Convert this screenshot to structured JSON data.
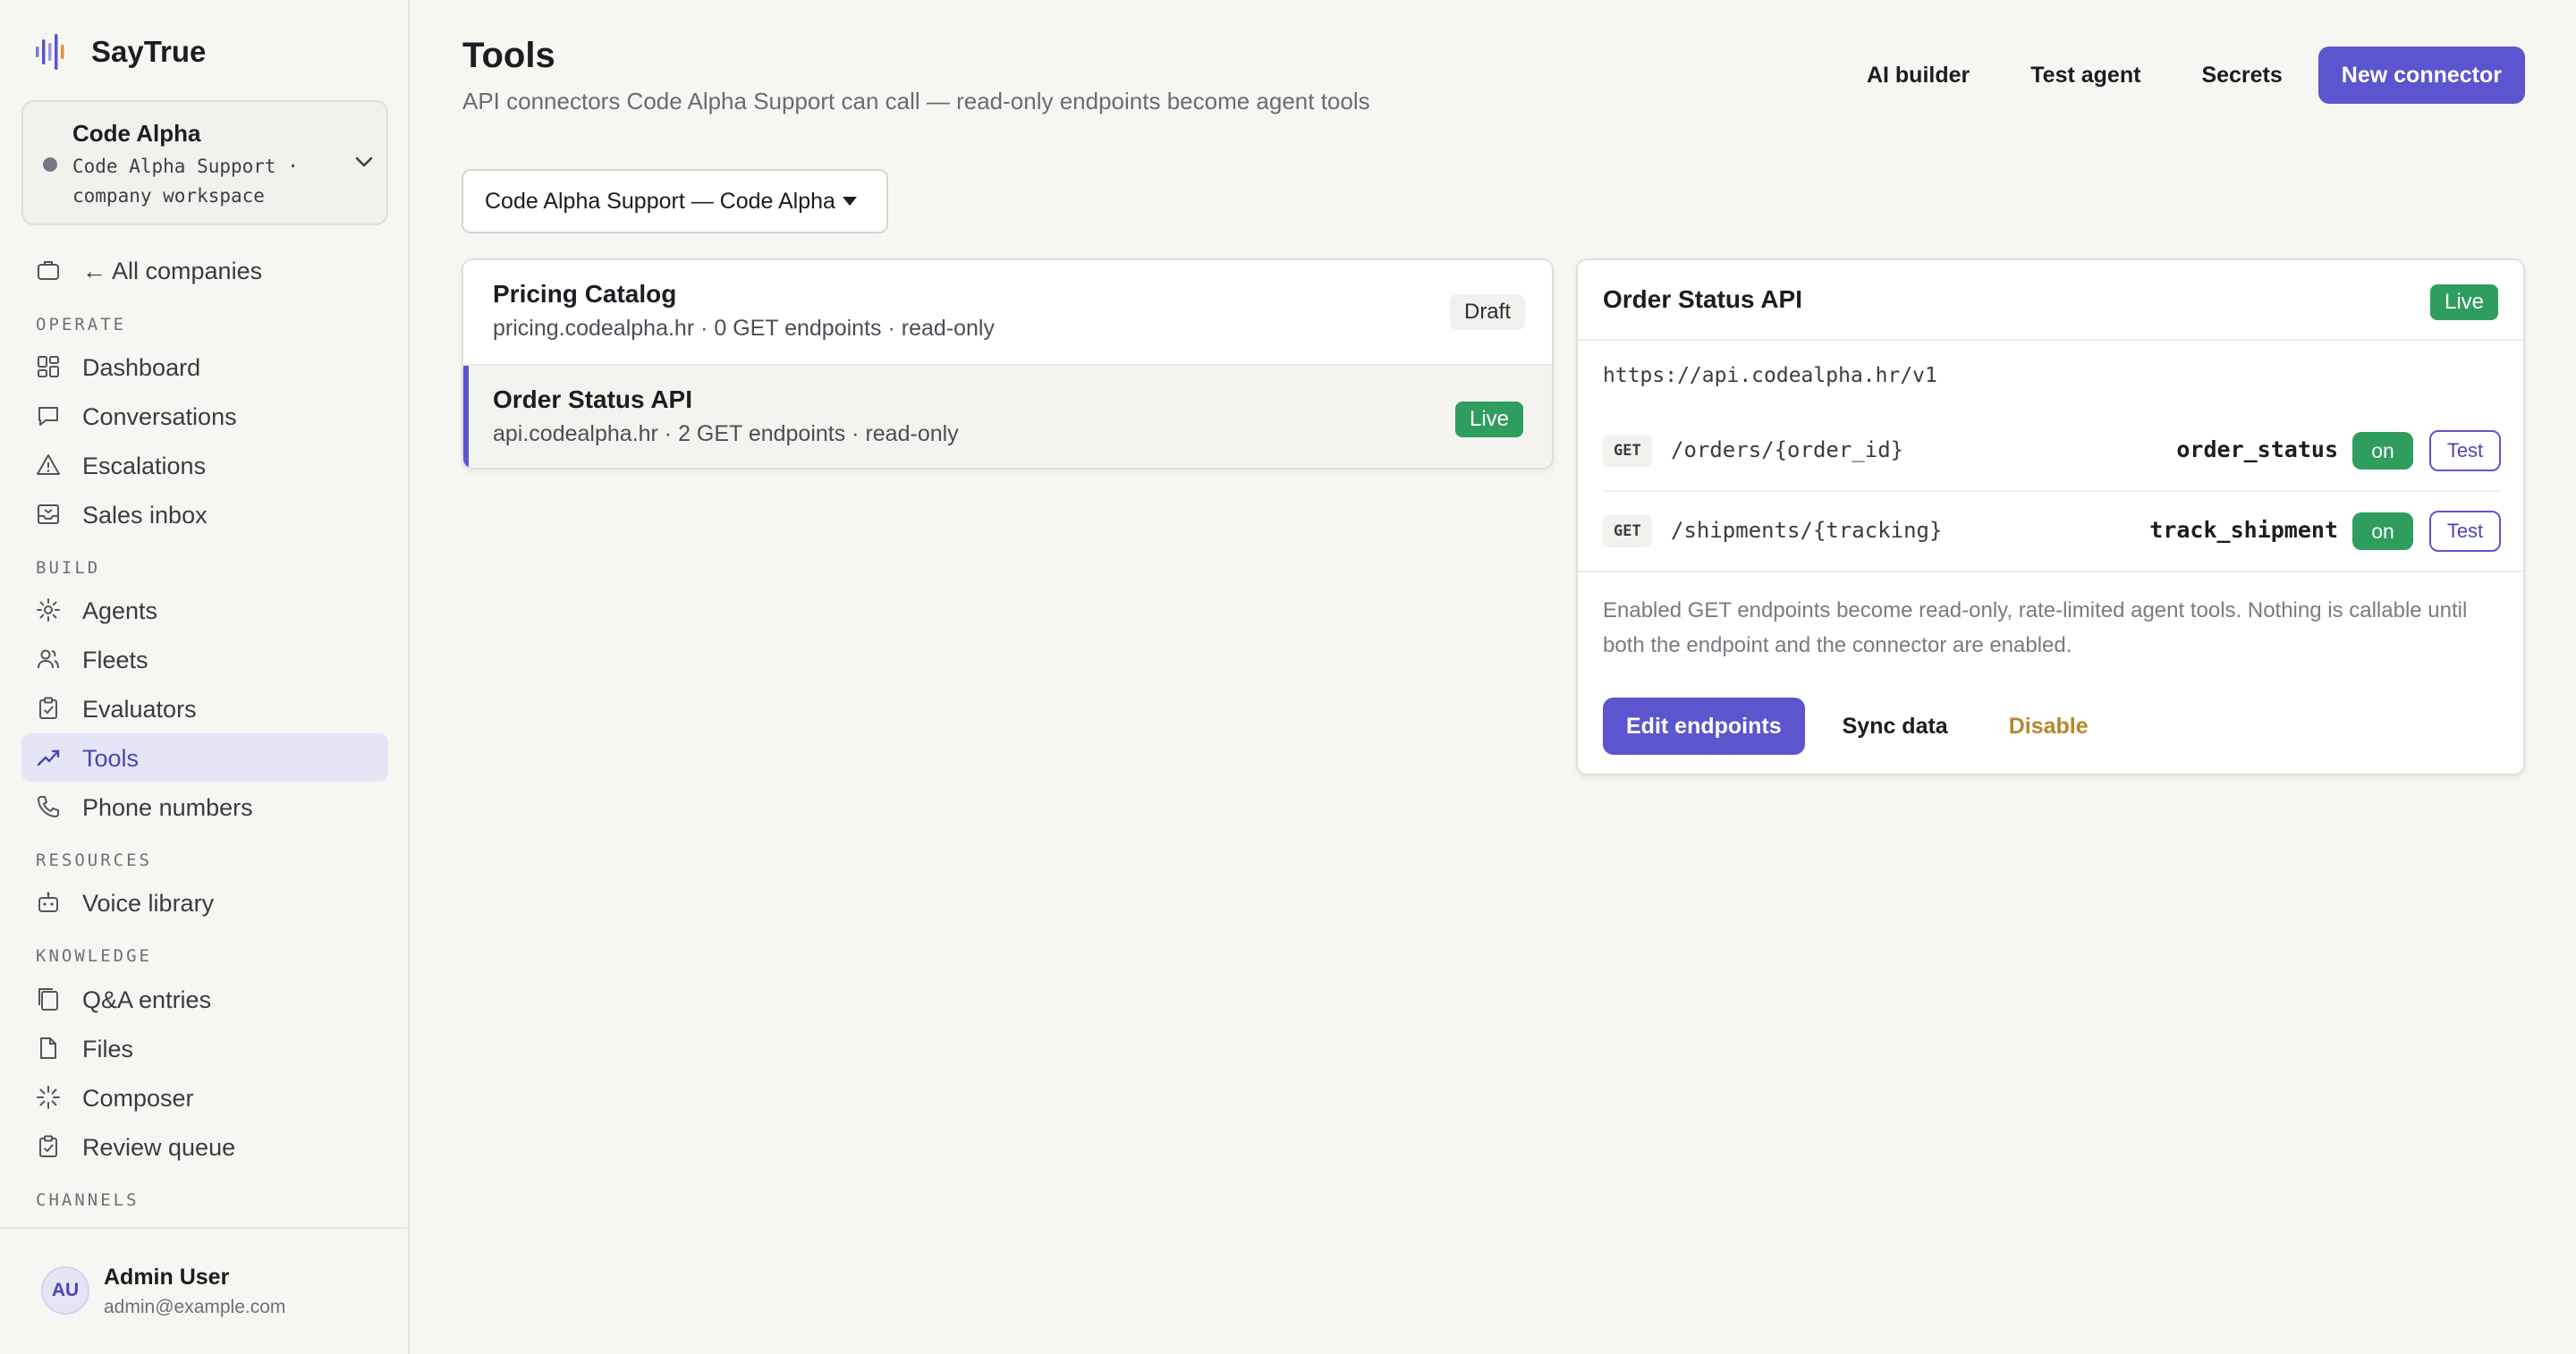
{
  "app": {
    "name": "SayTrue",
    "accent": "#5b55cf"
  },
  "company": {
    "name": "Code Alpha",
    "subtitle": "Code Alpha Support · company workspace"
  },
  "sidebar": {
    "back_label": "← All companies",
    "sections": {
      "operate": "OPERATE",
      "build": "BUILD",
      "resources": "RESOURCES",
      "knowledge": "KNOWLEDGE",
      "channels": "CHANNELS"
    },
    "items": {
      "dashboard": "Dashboard",
      "conversations": "Conversations",
      "escalations": "Escalations",
      "sales_inbox": "Sales inbox",
      "agents": "Agents",
      "fleets": "Fleets",
      "evaluators": "Evaluators",
      "tools": "Tools",
      "phone_numbers": "Phone numbers",
      "voice_library": "Voice library",
      "qa_entries": "Q&A entries",
      "files": "Files",
      "composer": "Composer",
      "review_queue": "Review queue"
    },
    "active": "tools"
  },
  "user": {
    "initials": "AU",
    "name": "Admin User",
    "email": "admin@example.com"
  },
  "header": {
    "title": "Tools",
    "subtitle": "API connectors Code Alpha Support can call — read-only endpoints become agent tools",
    "actions": {
      "ai_builder": "AI builder",
      "test_agent": "Test agent",
      "secrets": "Secrets",
      "new_connector": "New connector"
    }
  },
  "scope_select": {
    "value": "Code Alpha Support — Code Alpha"
  },
  "connectors": [
    {
      "name": "Pricing Catalog",
      "meta": "pricing.codealpha.hr · 0 GET endpoints · read-only",
      "status": "Draft"
    },
    {
      "name": "Order Status API",
      "meta": "api.codealpha.hr · 2 GET endpoints · read-only",
      "status": "Live"
    }
  ],
  "detail": {
    "title": "Order Status API",
    "status": "Live",
    "base_url": "https://api.codealpha.hr/v1",
    "endpoints": [
      {
        "method": "GET",
        "path": "/orders/{order_id}",
        "tool": "order_status",
        "toggle": "on",
        "test_label": "Test"
      },
      {
        "method": "GET",
        "path": "/shipments/{tracking}",
        "tool": "track_shipment",
        "toggle": "on",
        "test_label": "Test"
      }
    ],
    "note": "Enabled GET endpoints become read-only, rate-limited agent tools. Nothing is callable until both the endpoint and the connector are enabled.",
    "actions": {
      "edit": "Edit endpoints",
      "sync": "Sync data",
      "disable": "Disable"
    }
  },
  "colors": {
    "live": "#2f9d5e",
    "disable": "#b8862a",
    "active_bg": "#e6e5f6"
  }
}
